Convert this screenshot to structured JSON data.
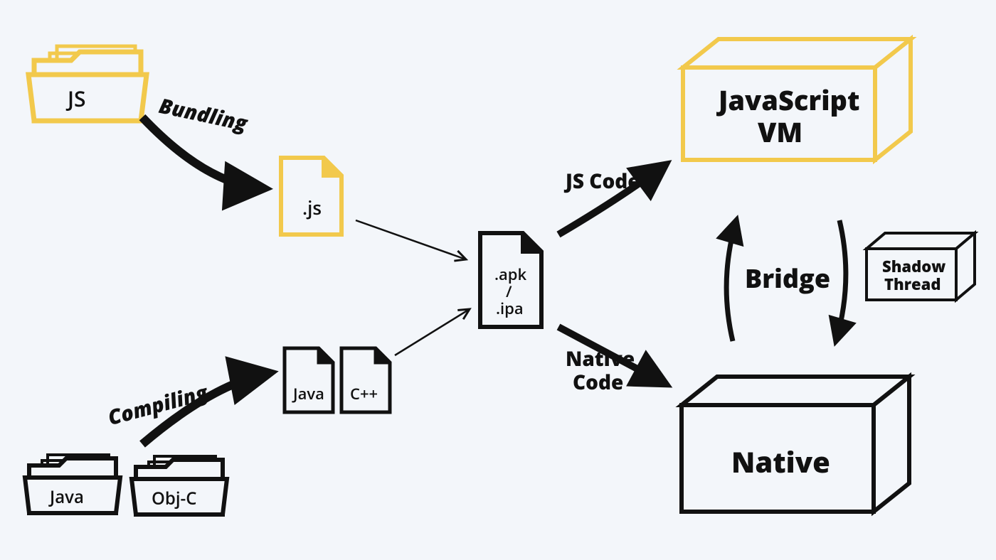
{
  "folders": {
    "js": "JS",
    "java": "Java",
    "objc": "Obj-C"
  },
  "files": {
    "js": ".js",
    "java": "Java",
    "cpp": "C++",
    "pkg_line1": ".apk",
    "pkg_line2": "/",
    "pkg_line3": ".ipa"
  },
  "arrows": {
    "bundling": "Bundling",
    "compiling": "Compiling",
    "js_code": "JS Code",
    "native_code_l1": "Native",
    "native_code_l2": "Code"
  },
  "boxes": {
    "jsvm_l1": "JavaScript",
    "jsvm_l2": "VM",
    "bridge": "Bridge",
    "shadow_l1": "Shadow",
    "shadow_l2": "Thread",
    "native": "Native"
  },
  "colors": {
    "yellow": "#f2c94c",
    "black": "#111111",
    "bg": "#f3f6fa"
  }
}
